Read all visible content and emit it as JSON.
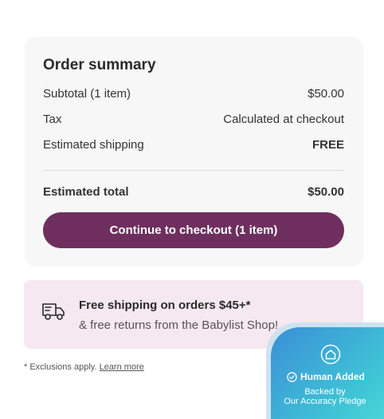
{
  "summary": {
    "title": "Order summary",
    "subtotal_label": "Subtotal (1 item)",
    "subtotal_value": "$50.00",
    "tax_label": "Tax",
    "tax_value": "Calculated at checkout",
    "shipping_label": "Estimated shipping",
    "shipping_value": "FREE",
    "total_label": "Estimated total",
    "total_value": "$50.00",
    "checkout_label": "Continue to checkout (1 item)"
  },
  "promo": {
    "icon": "truck-icon",
    "title": "Free shipping on orders $45+*",
    "subtitle": "& free returns from the Babylist Shop!"
  },
  "footnote": {
    "text": "* Exclusions apply.",
    "link": "Learn more"
  },
  "badge": {
    "icon": "shield-home-icon",
    "title": "Human Added",
    "line1": "Backed by",
    "line2": "Our Accuracy Pledge"
  },
  "colors": {
    "button": "#6e2f5f",
    "promo_bg": "#f6e8f0",
    "card_bg": "#f7f7f7"
  }
}
